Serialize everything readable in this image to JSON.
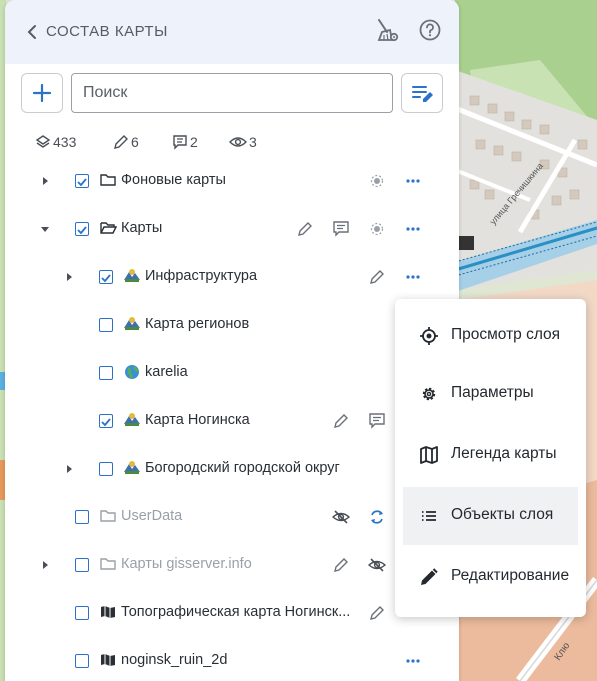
{
  "header": {
    "title": "СОСТАВ КАРТЫ"
  },
  "search": {
    "placeholder": "Поиск",
    "value": ""
  },
  "stats": {
    "layers": "433",
    "editable": "6",
    "comments": "2",
    "visible": "3"
  },
  "tree": [
    {
      "label": "Фоновые карты",
      "checked": true,
      "icon": "folder-icon",
      "expand": "collapsed"
    },
    {
      "label": "Карты",
      "checked": true,
      "icon": "folder-open-icon",
      "expand": "expanded"
    },
    {
      "label": "Инфраструктура",
      "checked": true,
      "icon": "map-layer-icon",
      "expand": "collapsed"
    },
    {
      "label": "Карта регионов",
      "checked": false,
      "icon": "map-layer-icon",
      "expand": "none"
    },
    {
      "label": "karelia",
      "checked": false,
      "icon": "globe-icon",
      "expand": "none"
    },
    {
      "label": "Карта Ногинска",
      "checked": true,
      "icon": "map-layer-icon",
      "expand": "none"
    },
    {
      "label": "Богородский городской округ",
      "checked": false,
      "icon": "map-layer-icon",
      "expand": "collapsed"
    },
    {
      "label": "UserData",
      "checked": false,
      "icon": "folder-icon",
      "expand": "none"
    },
    {
      "label": "Карты gisserver.info",
      "checked": false,
      "icon": "folder-icon",
      "expand": "collapsed"
    },
    {
      "label": "Топографическая карта Ногинск...",
      "checked": false,
      "icon": "map-icon",
      "expand": "none"
    },
    {
      "label": "noginsk_ruin_2d",
      "checked": false,
      "icon": "map-icon",
      "expand": "none"
    }
  ],
  "context_menu": {
    "items": [
      {
        "label": "Просмотр слоя",
        "icon": "target-icon"
      },
      {
        "label": "Параметры",
        "icon": "gear-icon"
      },
      {
        "label": "Легенда карты",
        "icon": "map-legend-icon"
      },
      {
        "label": "Объекты слоя",
        "icon": "list-icon"
      },
      {
        "label": "Редактирование",
        "icon": "pencil-icon"
      }
    ]
  },
  "map": {
    "street_label": "улица Гречишкина",
    "corner_label": "Клю"
  },
  "colors": {
    "accent": "#2a73c7",
    "header_bg": "#eef2fb",
    "text_muted": "#9aa0a8"
  }
}
